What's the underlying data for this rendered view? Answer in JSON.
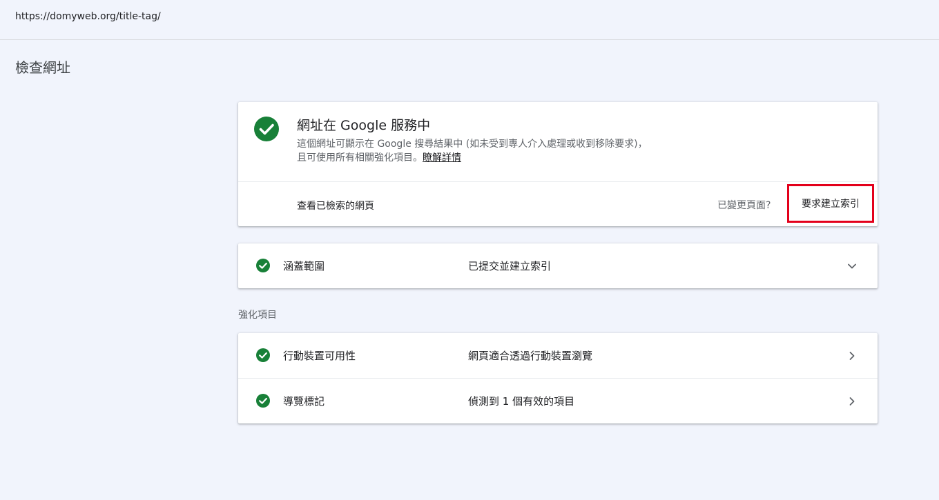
{
  "url_bar": {
    "url": "https://domyweb.org/title-tag/"
  },
  "page": {
    "title": "檢查網址"
  },
  "status_card": {
    "headline": "網址在 Google 服務中",
    "description_line1": "這個網址可顯示在 Google 搜尋結果中 (如未受到專人介入處理或收到移除要求)，",
    "description_line2": "且可使用所有相關強化項目。",
    "learn_more": "瞭解詳情",
    "view_crawled": "查看已檢索的網頁",
    "changed_question": "已變更頁面?",
    "request_indexing": "要求建立索引",
    "icon": "check-circle-icon"
  },
  "coverage": {
    "label": "涵蓋範圍",
    "value": "已提交並建立索引",
    "icon": "chevron-down-icon"
  },
  "enhancements": {
    "section_label": "強化項目",
    "items": [
      {
        "label": "行動裝置可用性",
        "value": "網頁適合透過行動裝置瀏覽",
        "icon": "chevron-right-icon"
      },
      {
        "label": "導覽標記",
        "value": "偵測到 1 個有效的項目",
        "icon": "chevron-right-icon"
      }
    ]
  },
  "colors": {
    "success_green": "#188038",
    "highlight_red": "#e3001b",
    "background": "#f1f4fc"
  }
}
